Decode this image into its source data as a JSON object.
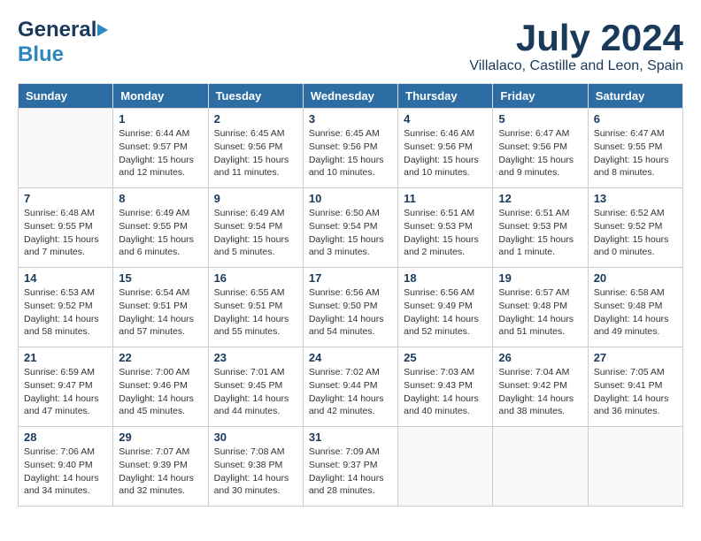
{
  "header": {
    "logo_general": "General",
    "logo_blue": "Blue",
    "month_year": "July 2024",
    "location": "Villalaco, Castille and Leon, Spain"
  },
  "days_of_week": [
    "Sunday",
    "Monday",
    "Tuesday",
    "Wednesday",
    "Thursday",
    "Friday",
    "Saturday"
  ],
  "weeks": [
    [
      {
        "day": "",
        "info": ""
      },
      {
        "day": "1",
        "info": "Sunrise: 6:44 AM\nSunset: 9:57 PM\nDaylight: 15 hours\nand 12 minutes."
      },
      {
        "day": "2",
        "info": "Sunrise: 6:45 AM\nSunset: 9:56 PM\nDaylight: 15 hours\nand 11 minutes."
      },
      {
        "day": "3",
        "info": "Sunrise: 6:45 AM\nSunset: 9:56 PM\nDaylight: 15 hours\nand 10 minutes."
      },
      {
        "day": "4",
        "info": "Sunrise: 6:46 AM\nSunset: 9:56 PM\nDaylight: 15 hours\nand 10 minutes."
      },
      {
        "day": "5",
        "info": "Sunrise: 6:47 AM\nSunset: 9:56 PM\nDaylight: 15 hours\nand 9 minutes."
      },
      {
        "day": "6",
        "info": "Sunrise: 6:47 AM\nSunset: 9:55 PM\nDaylight: 15 hours\nand 8 minutes."
      }
    ],
    [
      {
        "day": "7",
        "info": "Sunrise: 6:48 AM\nSunset: 9:55 PM\nDaylight: 15 hours\nand 7 minutes."
      },
      {
        "day": "8",
        "info": "Sunrise: 6:49 AM\nSunset: 9:55 PM\nDaylight: 15 hours\nand 6 minutes."
      },
      {
        "day": "9",
        "info": "Sunrise: 6:49 AM\nSunset: 9:54 PM\nDaylight: 15 hours\nand 5 minutes."
      },
      {
        "day": "10",
        "info": "Sunrise: 6:50 AM\nSunset: 9:54 PM\nDaylight: 15 hours\nand 3 minutes."
      },
      {
        "day": "11",
        "info": "Sunrise: 6:51 AM\nSunset: 9:53 PM\nDaylight: 15 hours\nand 2 minutes."
      },
      {
        "day": "12",
        "info": "Sunrise: 6:51 AM\nSunset: 9:53 PM\nDaylight: 15 hours\nand 1 minute."
      },
      {
        "day": "13",
        "info": "Sunrise: 6:52 AM\nSunset: 9:52 PM\nDaylight: 15 hours\nand 0 minutes."
      }
    ],
    [
      {
        "day": "14",
        "info": "Sunrise: 6:53 AM\nSunset: 9:52 PM\nDaylight: 14 hours\nand 58 minutes."
      },
      {
        "day": "15",
        "info": "Sunrise: 6:54 AM\nSunset: 9:51 PM\nDaylight: 14 hours\nand 57 minutes."
      },
      {
        "day": "16",
        "info": "Sunrise: 6:55 AM\nSunset: 9:51 PM\nDaylight: 14 hours\nand 55 minutes."
      },
      {
        "day": "17",
        "info": "Sunrise: 6:56 AM\nSunset: 9:50 PM\nDaylight: 14 hours\nand 54 minutes."
      },
      {
        "day": "18",
        "info": "Sunrise: 6:56 AM\nSunset: 9:49 PM\nDaylight: 14 hours\nand 52 minutes."
      },
      {
        "day": "19",
        "info": "Sunrise: 6:57 AM\nSunset: 9:48 PM\nDaylight: 14 hours\nand 51 minutes."
      },
      {
        "day": "20",
        "info": "Sunrise: 6:58 AM\nSunset: 9:48 PM\nDaylight: 14 hours\nand 49 minutes."
      }
    ],
    [
      {
        "day": "21",
        "info": "Sunrise: 6:59 AM\nSunset: 9:47 PM\nDaylight: 14 hours\nand 47 minutes."
      },
      {
        "day": "22",
        "info": "Sunrise: 7:00 AM\nSunset: 9:46 PM\nDaylight: 14 hours\nand 45 minutes."
      },
      {
        "day": "23",
        "info": "Sunrise: 7:01 AM\nSunset: 9:45 PM\nDaylight: 14 hours\nand 44 minutes."
      },
      {
        "day": "24",
        "info": "Sunrise: 7:02 AM\nSunset: 9:44 PM\nDaylight: 14 hours\nand 42 minutes."
      },
      {
        "day": "25",
        "info": "Sunrise: 7:03 AM\nSunset: 9:43 PM\nDaylight: 14 hours\nand 40 minutes."
      },
      {
        "day": "26",
        "info": "Sunrise: 7:04 AM\nSunset: 9:42 PM\nDaylight: 14 hours\nand 38 minutes."
      },
      {
        "day": "27",
        "info": "Sunrise: 7:05 AM\nSunset: 9:41 PM\nDaylight: 14 hours\nand 36 minutes."
      }
    ],
    [
      {
        "day": "28",
        "info": "Sunrise: 7:06 AM\nSunset: 9:40 PM\nDaylight: 14 hours\nand 34 minutes."
      },
      {
        "day": "29",
        "info": "Sunrise: 7:07 AM\nSunset: 9:39 PM\nDaylight: 14 hours\nand 32 minutes."
      },
      {
        "day": "30",
        "info": "Sunrise: 7:08 AM\nSunset: 9:38 PM\nDaylight: 14 hours\nand 30 minutes."
      },
      {
        "day": "31",
        "info": "Sunrise: 7:09 AM\nSunset: 9:37 PM\nDaylight: 14 hours\nand 28 minutes."
      },
      {
        "day": "",
        "info": ""
      },
      {
        "day": "",
        "info": ""
      },
      {
        "day": "",
        "info": ""
      }
    ]
  ]
}
